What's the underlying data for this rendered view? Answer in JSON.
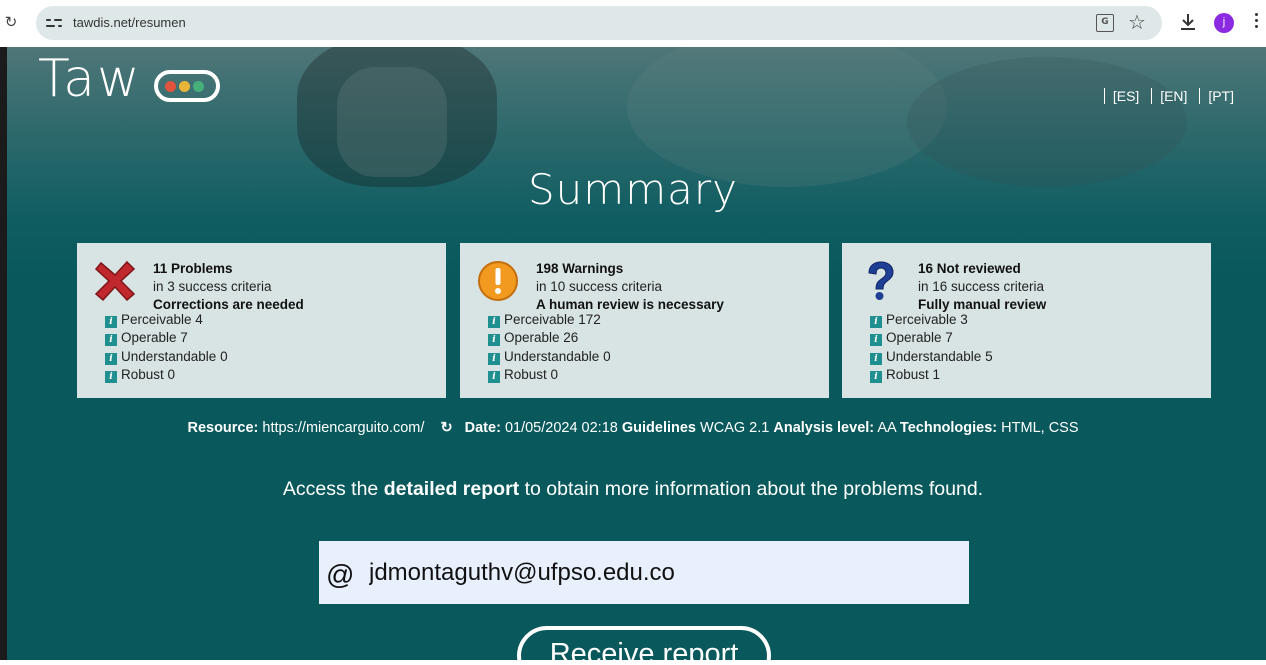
{
  "browser": {
    "url": "tawdis.net/resumen",
    "avatar_letter": "j",
    "avatar_color": "#8a2be2"
  },
  "header": {
    "logo_text": "Taw",
    "logo_light_colors": [
      "#e0533d",
      "#e8b53a",
      "#45b07a"
    ],
    "languages": [
      "[ES]",
      "[EN]",
      "[PT]"
    ]
  },
  "page_title": "Summary",
  "cards": [
    {
      "icon": "red-cross-icon",
      "count_label": "11 Problems",
      "criteria": "in 3 success criteria",
      "note": "Corrections are needed",
      "items": [
        "Perceivable 4",
        "Operable 7",
        "Understandable 0",
        "Robust 0"
      ]
    },
    {
      "icon": "orange-exclamation-icon",
      "count_label": "198 Warnings",
      "criteria": "in 10 success criteria",
      "note": "A human review is necessary",
      "items": [
        "Perceivable 172",
        "Operable 26",
        "Understandable 0",
        "Robust 0"
      ]
    },
    {
      "icon": "blue-question-icon",
      "count_label": "16 Not reviewed",
      "criteria": "in 16 success criteria",
      "note": "Fully manual review",
      "items": [
        "Perceivable 3",
        "Operable 7",
        "Understandable 5",
        "Robust 1"
      ]
    }
  ],
  "meta": {
    "resource_label": "Resource:",
    "resource_value": "https://miencarguito.com/",
    "date_label": "Date:",
    "date_value": "01/05/2024 02:18",
    "guidelines_label": "Guidelines",
    "guidelines_value": "WCAG 2.1",
    "level_label": "Analysis level:",
    "level_value": "AA",
    "tech_label": "Technologies:",
    "tech_value": "HTML, CSS"
  },
  "access": {
    "before": "Access the",
    "link": "detailed report",
    "after": "to obtain more information about the problems found."
  },
  "form": {
    "at_symbol": "@",
    "email_value": "jdmontaguthv@ufpso.edu.co",
    "submit_label": "Receive report"
  },
  "colors": {
    "page_bg": "#08585c",
    "card_bg": "#d8e3e3",
    "info_icon": "#1f8f8f"
  }
}
